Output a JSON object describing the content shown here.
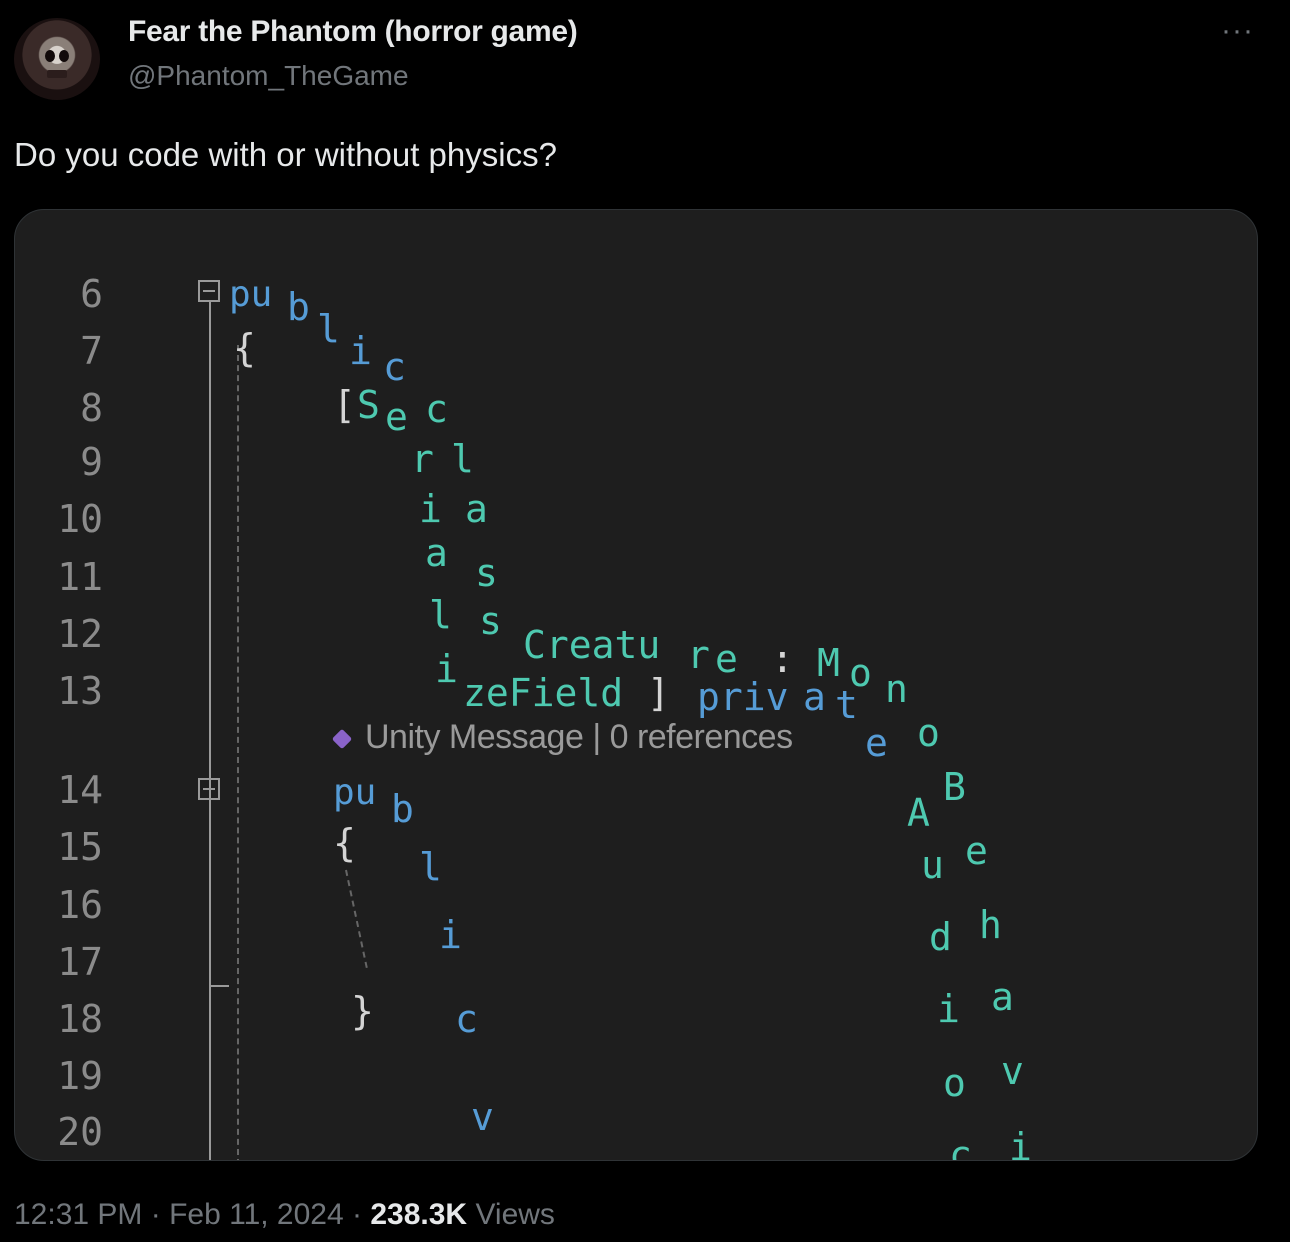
{
  "author": {
    "display_name": "Fear the Phantom (horror game)",
    "handle": "@Phantom_TheGame",
    "avatar_icon": "skull-avatar-icon"
  },
  "more_label": "···",
  "tweet_text": "Do you code with or without physics?",
  "code_image": {
    "line_numbers": [
      "6",
      "7",
      "8",
      "9",
      "10",
      "11",
      "12",
      "13",
      "14",
      "15",
      "16",
      "17",
      "18",
      "19",
      "20"
    ],
    "codelens": "Unity Message | 0 references"
  },
  "footer": {
    "time": "12:31 PM",
    "date": "Feb 11, 2024",
    "views_count": "238.3K",
    "views_label": "Views"
  }
}
